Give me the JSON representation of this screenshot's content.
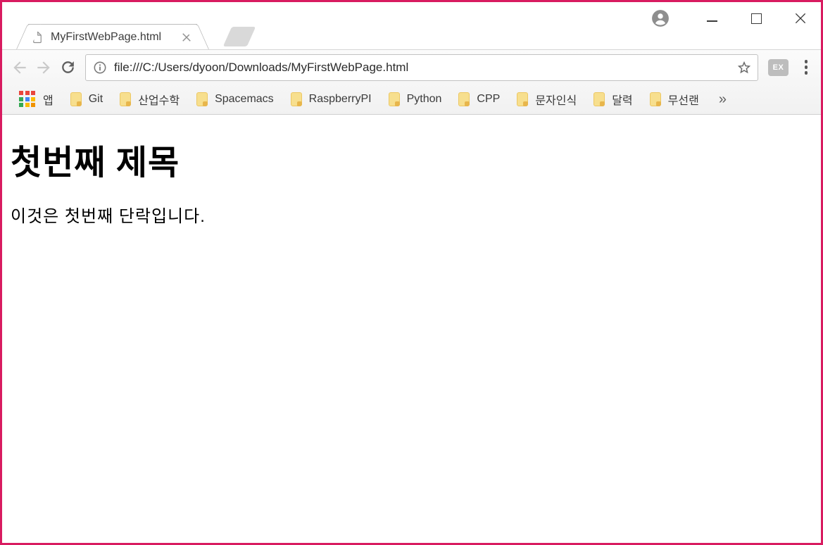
{
  "window": {
    "accent_border_color": "#d81b60",
    "controls": {
      "avatar_icon": "profile-avatar",
      "minimize_icon": "minimize",
      "maximize_icon": "maximize",
      "close_icon": "close"
    }
  },
  "tab": {
    "title": "MyFirstWebPage.html",
    "favicon": "document-icon",
    "close_icon": "close-x"
  },
  "toolbar": {
    "back_icon": "back-arrow",
    "forward_icon": "forward-arrow",
    "reload_icon": "reload-arrow",
    "info_icon": "page-info",
    "url": "file:///C:/Users/dyoon/Downloads/MyFirstWebPage.html",
    "star_icon": "bookmark-star",
    "extension_badge": "EX",
    "menu_icon": "kebab-menu"
  },
  "bookmarks_bar": {
    "apps_label": "앱",
    "apps_grid_colors": [
      "#e8453c",
      "#e8453c",
      "#e8453c",
      "#34a853",
      "#4285f4",
      "#fbbc05",
      "#34a853",
      "#fbbc05",
      "#f09300"
    ],
    "folder_color": "#f7df8e",
    "items": [
      "Git",
      "산업수학",
      "Spacemacs",
      "RaspberryPI",
      "Python",
      "CPP",
      "문자인식",
      "달력",
      "무선랜"
    ],
    "overflow": "»"
  },
  "page": {
    "heading": "첫번째 제목",
    "paragraph": "이것은 첫번째 단락입니다."
  }
}
